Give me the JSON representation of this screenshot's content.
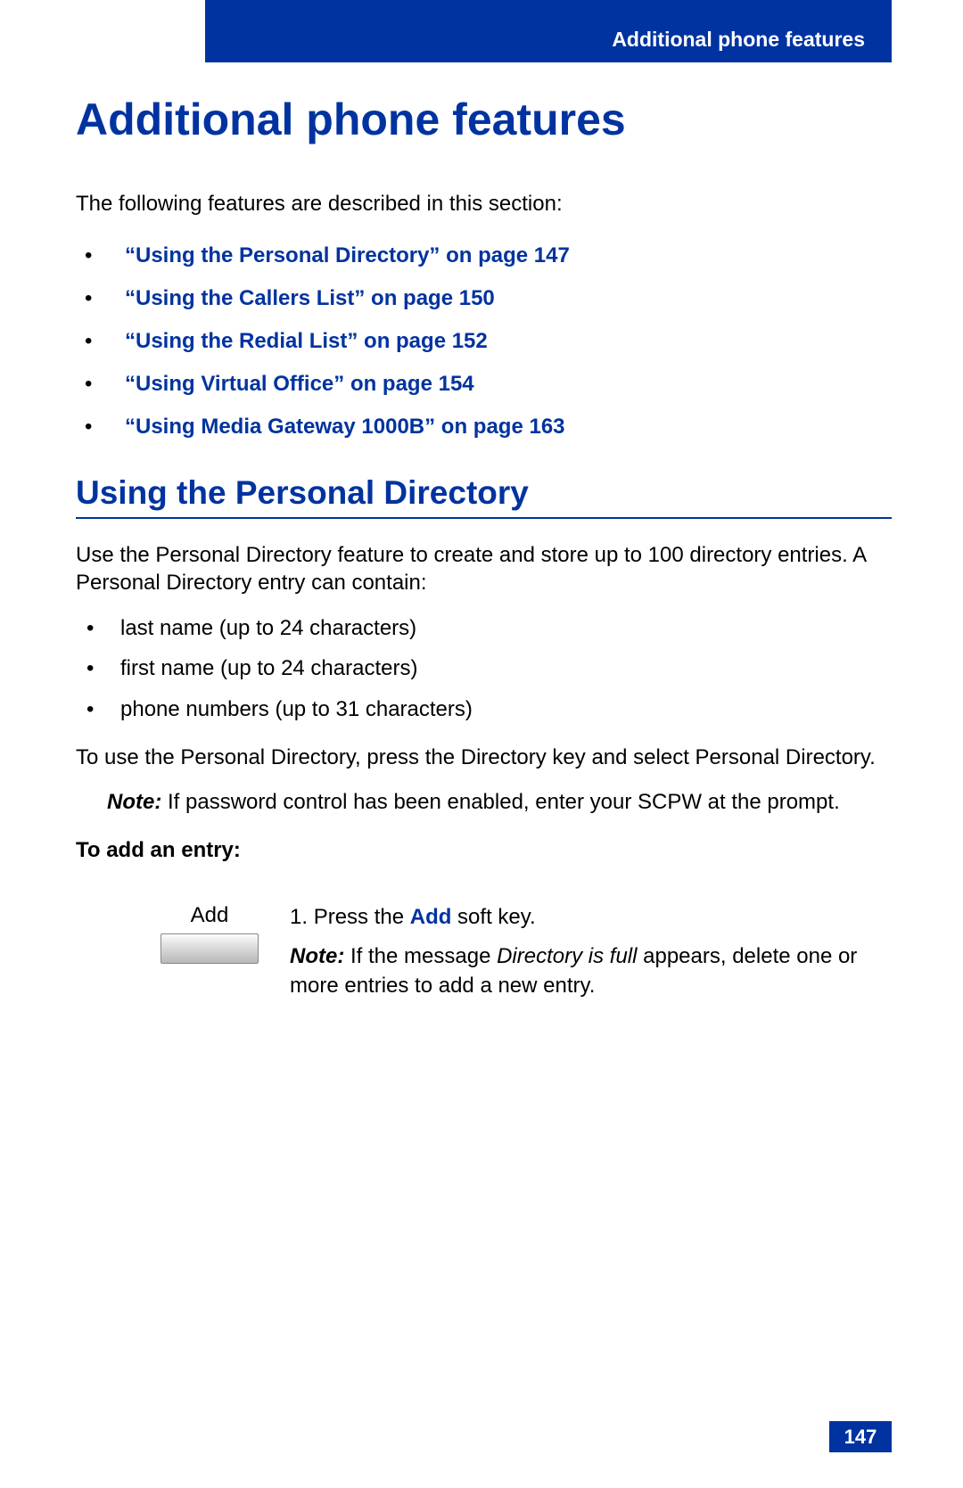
{
  "header": {
    "section_label": "Additional phone features"
  },
  "chapter": {
    "title": "Additional phone features"
  },
  "intro": "The following features are described in this section:",
  "toc_links": [
    "“Using the Personal Directory” on page 147",
    "“Using the Callers List” on page 150",
    "“Using the Redial List” on page 152",
    "“Using Virtual Office” on page 154",
    "“Using Media Gateway 1000B” on page 163"
  ],
  "section": {
    "title": "Using the Personal Directory",
    "para1": "Use the Personal Directory feature to create and store up to 100 directory entries. A Personal Directory entry can contain:",
    "bullets": [
      "last name (up to 24 characters)",
      "first name (up to 24 characters)",
      "phone numbers (up to 31 characters)"
    ],
    "para2": "To use the Personal Directory, press the Directory key and select Personal Directory.",
    "note_label": "Note:",
    "note_text": " If password control has been enabled, enter your SCPW at the prompt.",
    "subhead": "To add an entry:",
    "softkey_label": "Add",
    "step1_num": "1.",
    "step1_prefix": "Press the ",
    "step1_kw": "Add",
    "step1_suffix": " soft key.",
    "step1_note_label": "Note:",
    "step1_note_prefix": " If the message ",
    "step1_note_italic": "Directory is full",
    "step1_note_suffix": " appears, delete one or more entries to add a new entry."
  },
  "page_number": "147"
}
